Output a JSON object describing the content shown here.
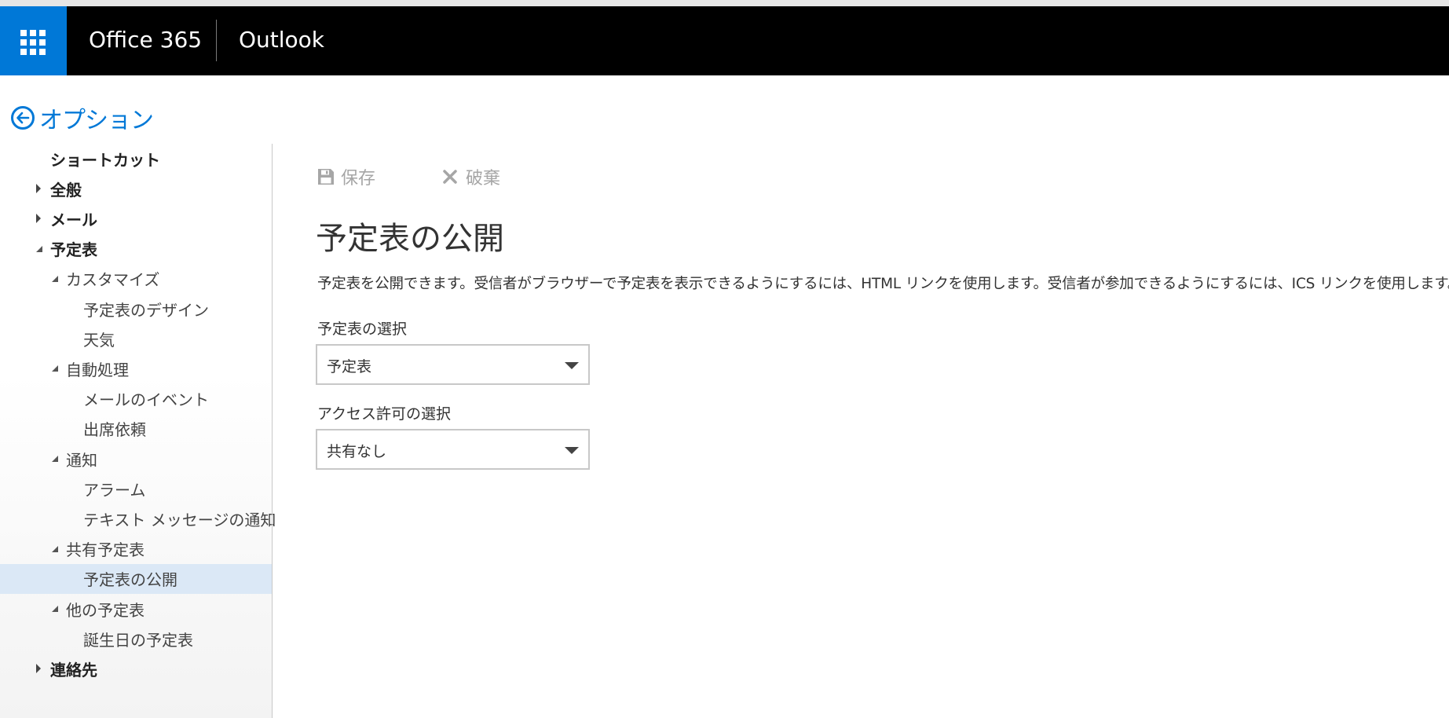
{
  "header": {
    "brand": "Office 365",
    "app": "Outlook",
    "colors": {
      "bar": "#000000",
      "waffle": "#0078d7"
    }
  },
  "back": {
    "title": "オプション"
  },
  "nav": {
    "items": [
      {
        "label": "ショートカット",
        "level": 1,
        "expander": "none"
      },
      {
        "label": "全般",
        "level": 1,
        "expander": "collapsed"
      },
      {
        "label": "メール",
        "level": 1,
        "expander": "collapsed"
      },
      {
        "label": "予定表",
        "level": 1,
        "expander": "expanded"
      },
      {
        "label": "カスタマイズ",
        "level": 2,
        "expander": "expanded"
      },
      {
        "label": "予定表のデザイン",
        "level": 3,
        "expander": "none"
      },
      {
        "label": "天気",
        "level": 3,
        "expander": "none"
      },
      {
        "label": "自動処理",
        "level": 2,
        "expander": "expanded"
      },
      {
        "label": "メールのイベント",
        "level": 3,
        "expander": "none"
      },
      {
        "label": "出席依頼",
        "level": 3,
        "expander": "none"
      },
      {
        "label": "通知",
        "level": 2,
        "expander": "expanded"
      },
      {
        "label": "アラーム",
        "level": 3,
        "expander": "none"
      },
      {
        "label": "テキスト メッセージの通知",
        "level": 3,
        "expander": "none"
      },
      {
        "label": "共有予定表",
        "level": 2,
        "expander": "expanded"
      },
      {
        "label": "予定表の公開",
        "level": 3,
        "expander": "none",
        "selected": true
      },
      {
        "label": "他の予定表",
        "level": 2,
        "expander": "expanded"
      },
      {
        "label": "誕生日の予定表",
        "level": 3,
        "expander": "none"
      },
      {
        "label": "連絡先",
        "level": 1,
        "expander": "collapsed"
      }
    ]
  },
  "toolbar": {
    "save_label": "保存",
    "discard_label": "破棄"
  },
  "main": {
    "title": "予定表の公開",
    "description": "予定表を公開できます。受信者がブラウザーで予定表を表示できるようにするには、HTML リンクを使用します。受信者が参加できるようにするには、ICS リンクを使用します。",
    "calendar_select": {
      "label": "予定表の選択",
      "value": "予定表"
    },
    "permission_select": {
      "label": "アクセス許可の選択",
      "value": "共有なし"
    }
  }
}
